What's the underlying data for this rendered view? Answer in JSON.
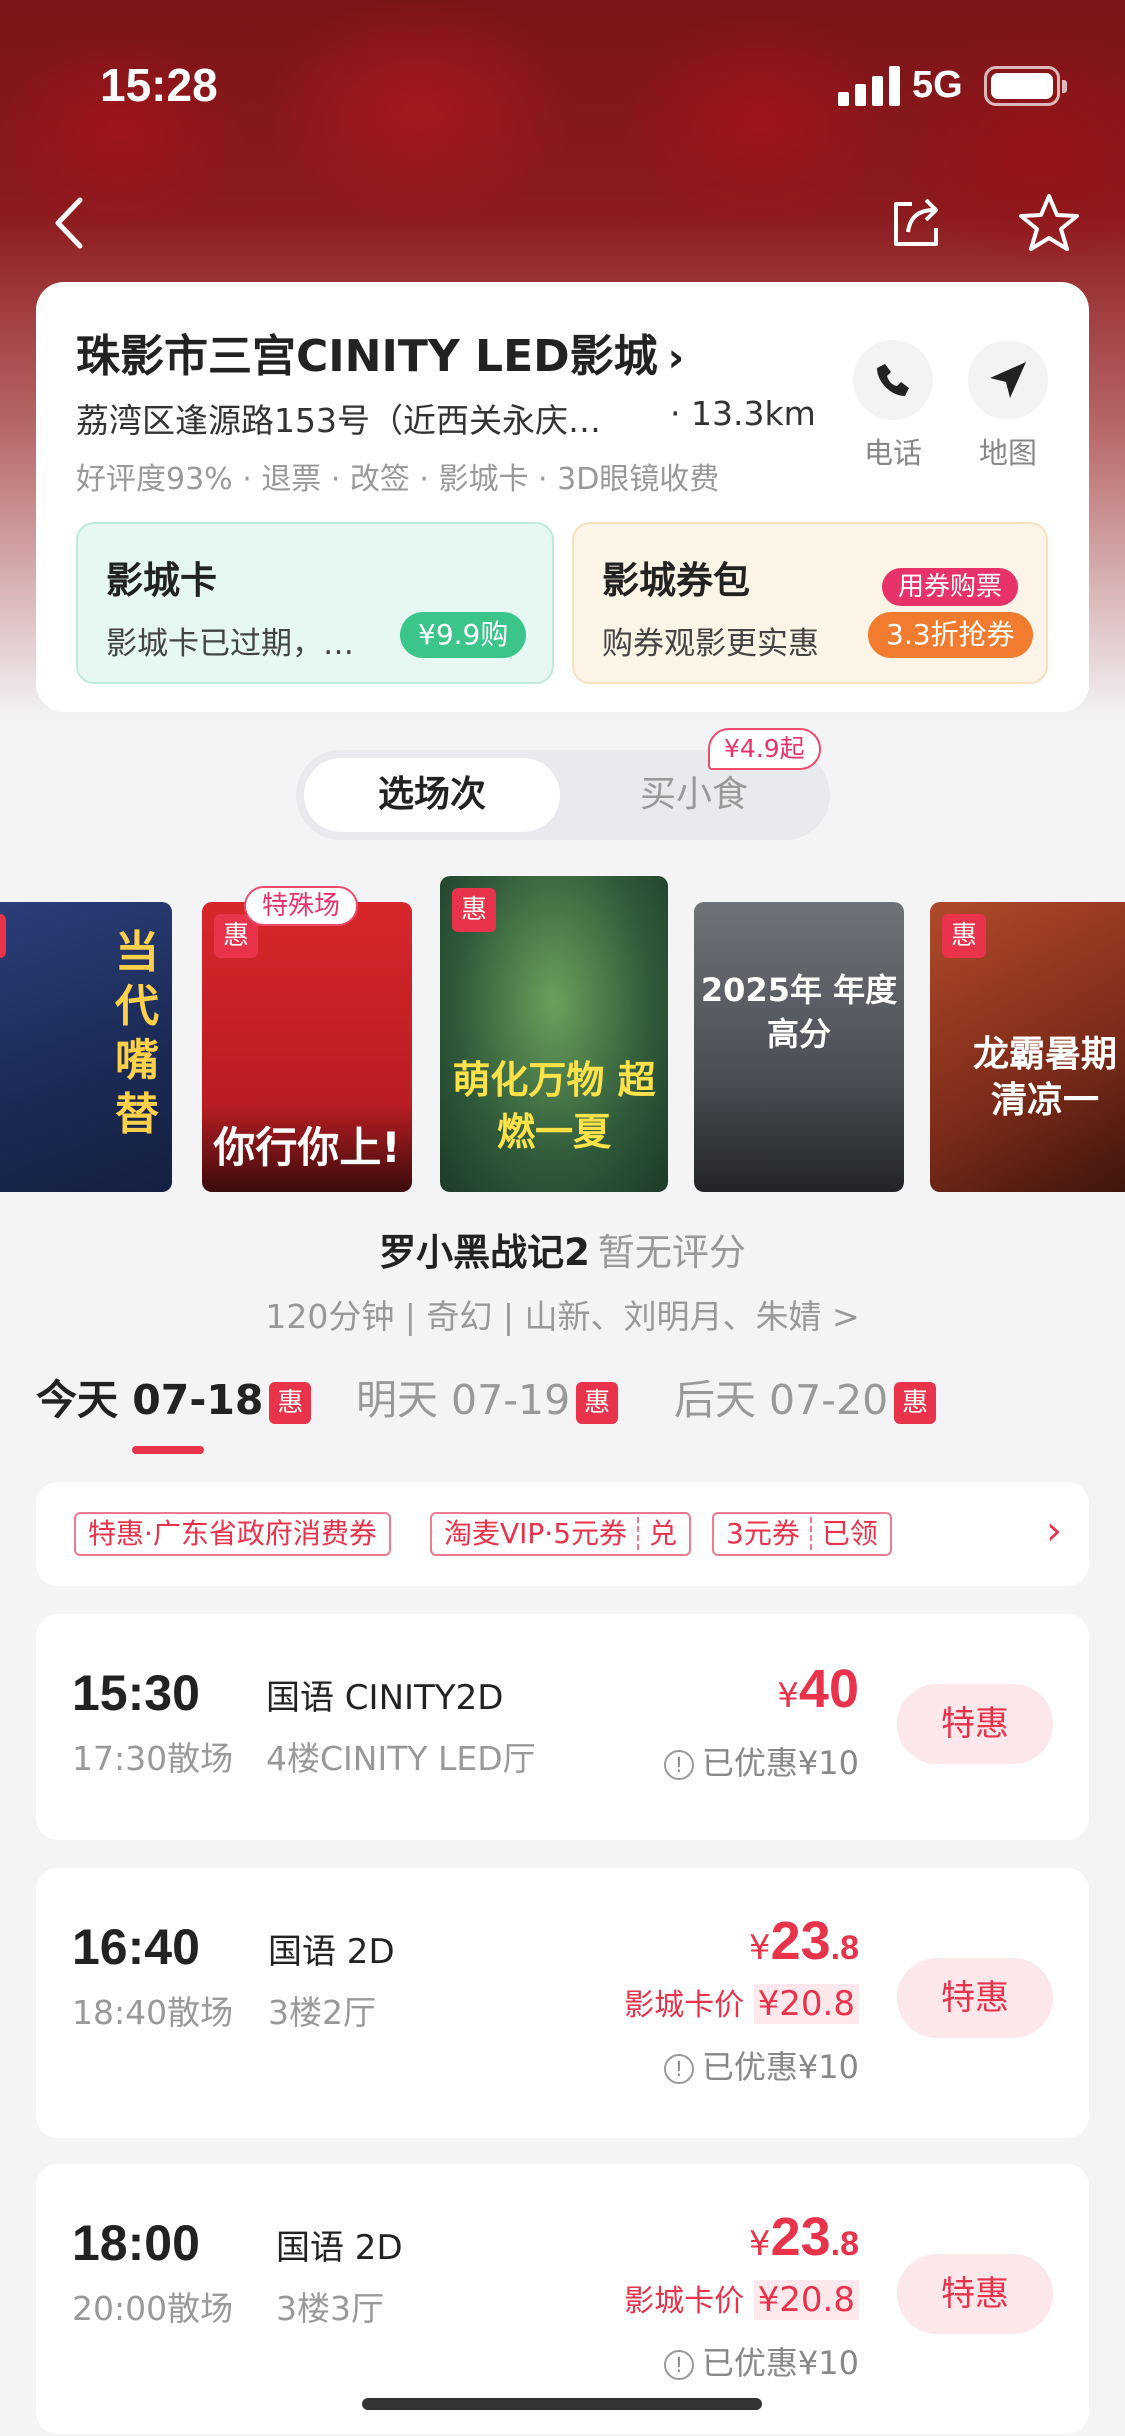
{
  "status": {
    "time": "15:28",
    "network": "5G"
  },
  "cinema": {
    "name": "珠影市三宫CINITY LED影城",
    "address": "荔湾区逢源路153号（近西关永庆…",
    "distance": "· 13.3km",
    "tags": "好评度93% · 退票 · 改签 · 影城卡 · 3D眼镜收费",
    "phone_label": "电话",
    "map_label": "地图"
  },
  "promos": {
    "card": {
      "title": "影城卡",
      "desc": "影城卡已过期，…",
      "button": "¥9.9购"
    },
    "coupon": {
      "title": "影城券包",
      "desc": "购券观影更实惠",
      "tag": "用券购票",
      "button": "3.3折抢券"
    }
  },
  "segment": {
    "active": "选场次",
    "other": "买小食",
    "badge": "¥4.9起"
  },
  "posters": {
    "special_tag": "特殊场",
    "hui": "惠",
    "items": [
      {
        "text": "当代嘴替"
      },
      {
        "text": "你行你上!"
      },
      {
        "text": "萌化万物 超燃一夏"
      },
      {
        "text": "2025年 年度 高分"
      },
      {
        "text": "龙霸暑期 清凉一"
      }
    ]
  },
  "movie": {
    "title": "罗小黑战记2",
    "score": "暂无评分",
    "meta": "120分钟 | 奇幻 | 山新、刘明月、朱婧 >"
  },
  "dates": [
    {
      "label": "今天 07-18",
      "badge": "惠"
    },
    {
      "label": "明天 07-19",
      "badge": "惠"
    },
    {
      "label": "后天 07-20",
      "badge": "惠"
    }
  ],
  "coupons": {
    "tag1": "特惠·广东省政府消费券",
    "tag2": "淘麦VIP·5元券",
    "tag2_action": "兑",
    "tag3": "3元券",
    "tag3_action": "已领"
  },
  "showtimes": [
    {
      "time": "15:30",
      "end": "17:30散场",
      "lang": "国语 CINITY2D",
      "hall": "4楼CINITY LED厅",
      "yen": "¥",
      "price": "40",
      "price_dec": "",
      "card_label": "",
      "card_price": "",
      "saved": "已优惠¥10",
      "button": "特惠"
    },
    {
      "time": "16:40",
      "end": "18:40散场",
      "lang": "国语 2D",
      "hall": "3楼2厅",
      "yen": "¥",
      "price": "23",
      "price_dec": ".8",
      "card_label": "影城卡价",
      "card_price": "¥20.8",
      "saved": "已优惠¥10",
      "button": "特惠"
    },
    {
      "time": "18:00",
      "end": "20:00散场",
      "lang": "国语 2D",
      "hall": "3楼3厅",
      "yen": "¥",
      "price": "23",
      "price_dec": ".8",
      "card_label": "影城卡价",
      "card_price": "¥20.8",
      "saved": "已优惠¥10",
      "button": "特惠"
    }
  ],
  "colors": {
    "accent": "#e8334a",
    "green": "#3cc58b",
    "orange": "#f17c30"
  }
}
